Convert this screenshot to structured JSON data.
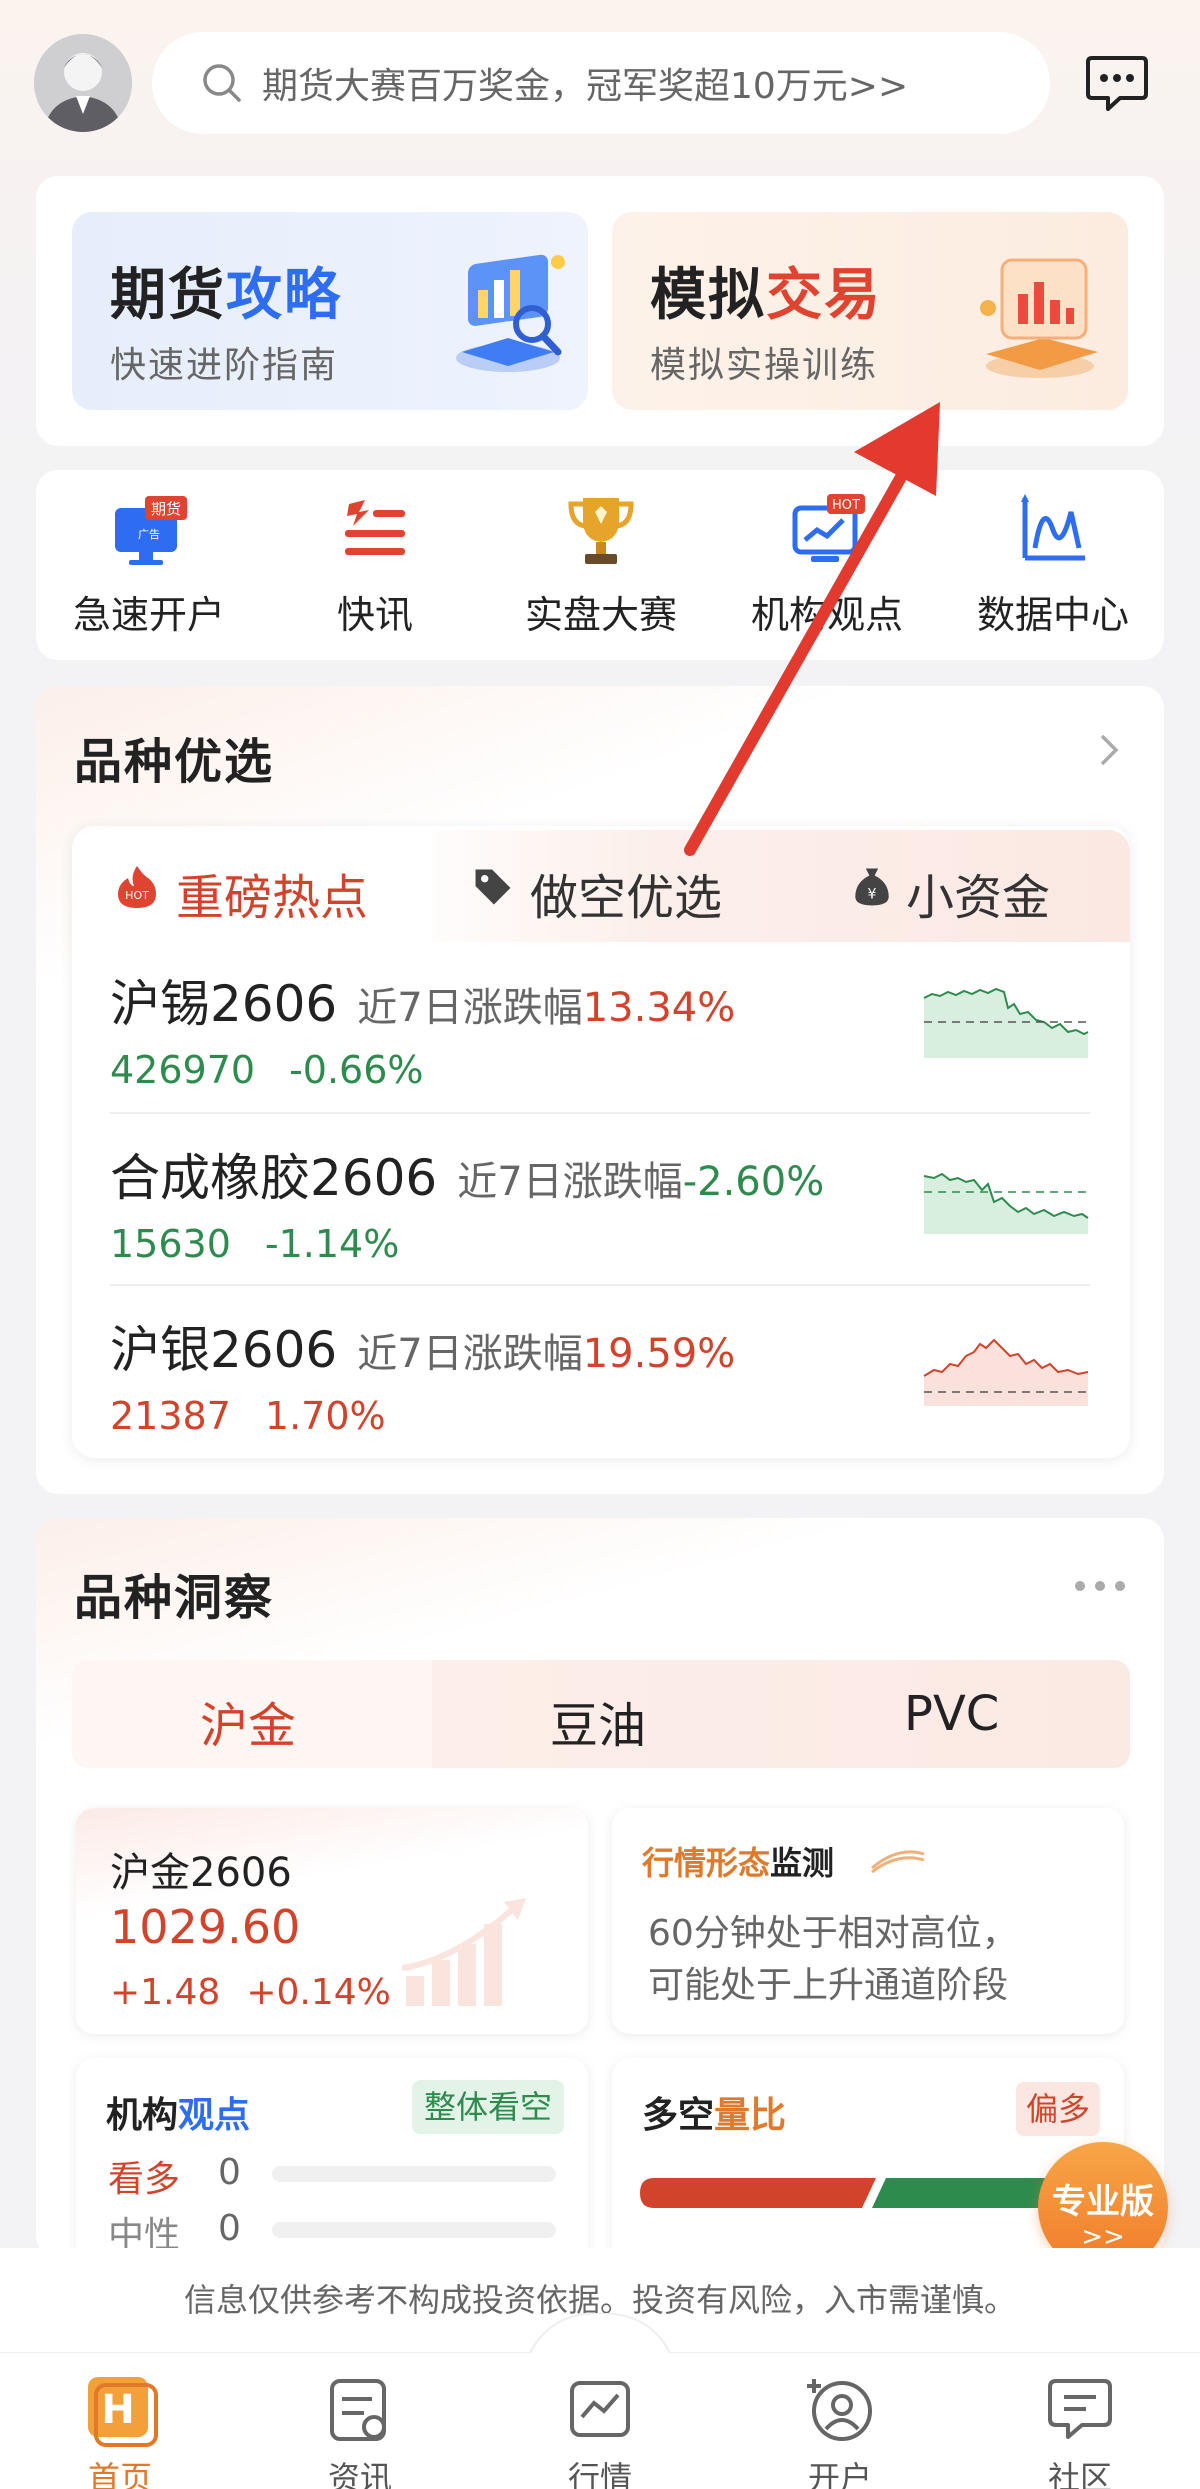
{
  "header": {
    "search_placeholder": "期货大赛百万奖金，冠军奖超10万元>>"
  },
  "feature_tiles": [
    {
      "title_a": "期货",
      "title_b": "攻略",
      "subtitle": "快速进阶指南"
    },
    {
      "title_a": "模拟",
      "title_b": "交易",
      "subtitle": "模拟实操训练"
    }
  ],
  "quick_menu": [
    {
      "label": "急速开户",
      "icon": "account-open-icon",
      "badge": "期货",
      "badge_sub": "广告"
    },
    {
      "label": "快讯",
      "icon": "news-flash-icon"
    },
    {
      "label": "实盘大赛",
      "icon": "trophy-icon"
    },
    {
      "label": "机构观点",
      "icon": "institution-view-icon",
      "badge": "HOT"
    },
    {
      "label": "数据中心",
      "icon": "data-center-icon"
    }
  ],
  "selection": {
    "title": "品种优选",
    "tabs": [
      {
        "label": "重磅热点",
        "icon": "hot-icon",
        "icon_text": "HOT"
      },
      {
        "label": "做空优选",
        "icon": "tag-icon"
      },
      {
        "label": "小资金",
        "icon": "money-bag-icon",
        "icon_text": "¥"
      }
    ],
    "items": [
      {
        "name": "沪锡2606",
        "change_label": "近7日涨跌幅",
        "change7d": "13.34%",
        "price": "426970",
        "change": "-0.66%",
        "trend": "down"
      },
      {
        "name": "合成橡胶2606",
        "change_label": "近7日涨跌幅",
        "change7d": "-2.60%",
        "price": "15630",
        "change": "-1.14%",
        "trend": "down"
      },
      {
        "name": "沪银2606",
        "change_label": "近7日涨跌幅",
        "change7d": "19.59%",
        "price": "21387",
        "change": "1.70%",
        "trend": "up"
      }
    ]
  },
  "insight": {
    "title": "品种洞察",
    "tabs": [
      "沪金",
      "豆油",
      "PVC"
    ],
    "quote": {
      "name": "沪金2606",
      "price": "1029.60",
      "change": "+1.48",
      "change_pct": "+0.14%"
    },
    "pattern": {
      "title_a": "行情形态",
      "title_b": "监测",
      "text_line1": "60分钟处于相对高位，",
      "text_line2": "可能处于上升通道阶段"
    },
    "institution": {
      "title_a": "机构",
      "title_b": "观点",
      "badge": "整体看空",
      "rows": [
        {
          "label": "看多",
          "value": "0"
        },
        {
          "label": "中性",
          "value": "0"
        }
      ]
    },
    "long_short": {
      "title_a": "多空",
      "title_b": "量比",
      "badge": "偏多",
      "long_ratio": 0.48
    }
  },
  "pro_badge": {
    "label": "专业版",
    "arrow": ">>"
  },
  "disclaimer": "信息仅供参考不构成投资依据。投资有风险，入市需谨慎。",
  "tabbar": [
    {
      "label": "首页",
      "icon": "home-icon",
      "active": true,
      "glyph": "H"
    },
    {
      "label": "资讯",
      "icon": "news-icon"
    },
    {
      "label": "行情",
      "icon": "market-chart-icon"
    },
    {
      "label": "开户",
      "icon": "open-account-icon"
    },
    {
      "label": "社区",
      "icon": "community-icon"
    }
  ],
  "colors": {
    "red": "#d2432b",
    "green": "#2e8b4e",
    "blue": "#2f6df0",
    "orange": "#f07a2a"
  }
}
